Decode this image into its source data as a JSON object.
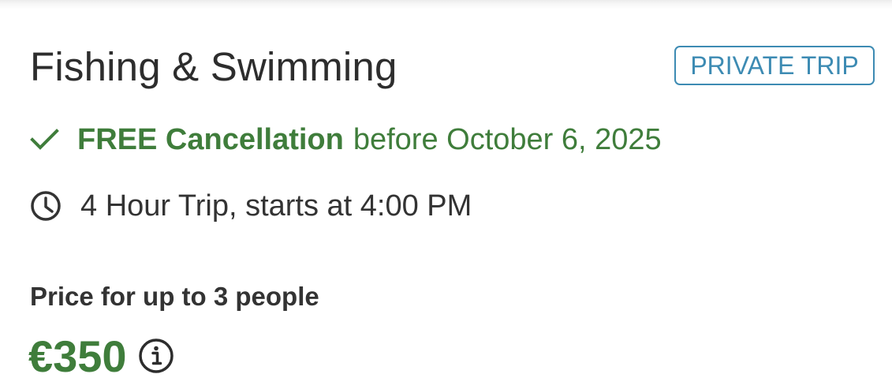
{
  "trip": {
    "title": "Fishing & Swimming",
    "badge": "PRIVATE TRIP"
  },
  "cancellation": {
    "strong": "FREE Cancellation",
    "rest": "before October 6, 2025",
    "icon": "check-icon",
    "color": "#3f7d3b"
  },
  "duration": {
    "text": "4 Hour Trip, starts at 4:00 PM",
    "icon": "clock-icon"
  },
  "price": {
    "label": "Price for up to 3 people",
    "value": "€350",
    "info_icon": "info-icon",
    "color": "#3f7d3b"
  },
  "colors": {
    "accent_blue": "#3d8bb3",
    "text_dark": "#333333"
  }
}
